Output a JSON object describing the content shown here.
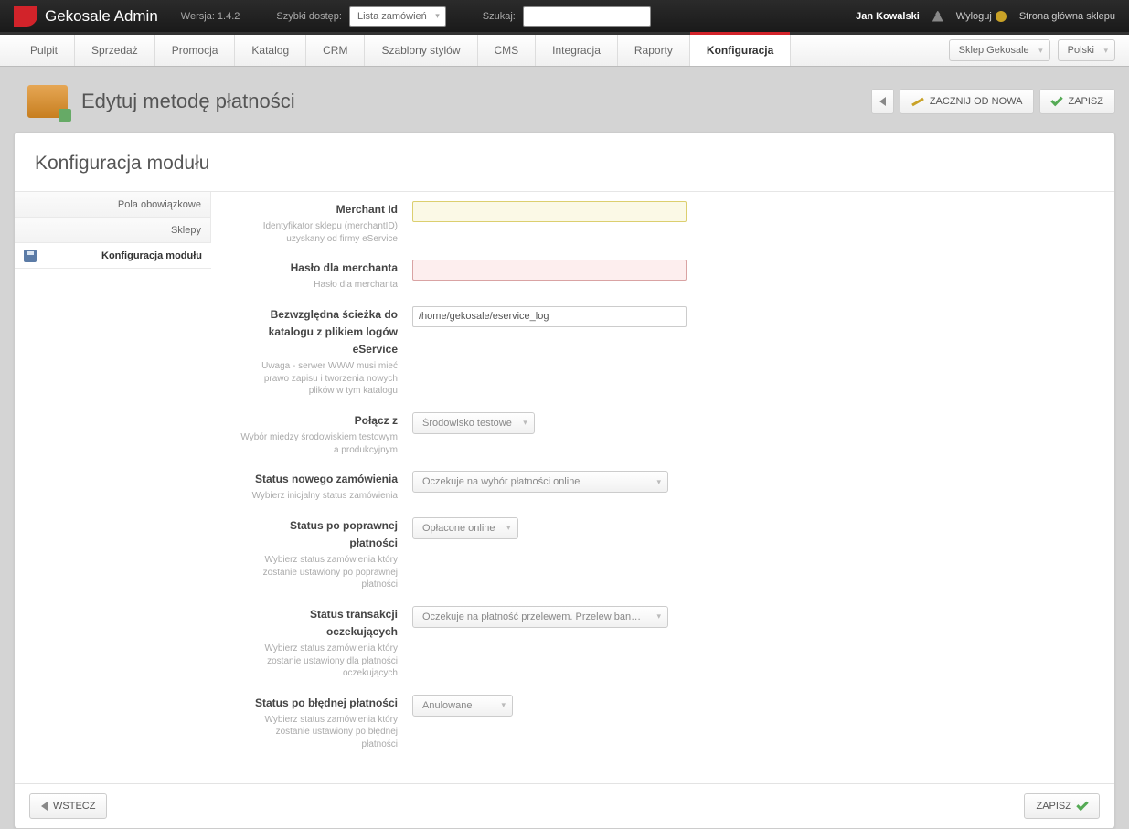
{
  "topbar": {
    "brand": "Gekosale Admin",
    "version": "Wersja: 1.4.2",
    "quick_access_label": "Szybki dostęp:",
    "quick_access_value": "Lista zamówień",
    "search_label": "Szukaj:",
    "search_value": "",
    "user": "Jan Kowalski",
    "logout": "Wyloguj",
    "storefront": "Strona główna sklepu"
  },
  "mainnav": {
    "items": [
      "Pulpit",
      "Sprzedaż",
      "Promocja",
      "Katalog",
      "CRM",
      "Szablony stylów",
      "CMS",
      "Integracja",
      "Raporty",
      "Konfiguracja"
    ],
    "active": "Konfiguracja",
    "shop_select": "Sklep Gekosale",
    "lang_select": "Polski"
  },
  "pagehead": {
    "title": "Edytuj metodę płatności",
    "back_tooltip": "Wstecz",
    "restart": "ZACZNIJ OD NOWA",
    "save": "ZAPISZ"
  },
  "panel": {
    "title": "Konfiguracja modułu"
  },
  "sidenav": {
    "items": [
      "Pola obowiązkowe",
      "Sklepy",
      "Konfiguracja modułu"
    ],
    "active": "Konfiguracja modułu"
  },
  "form": {
    "merchant_id": {
      "label": "Merchant Id",
      "help": "Identyfikator sklepu (merchantID) uzyskany od firmy eService",
      "value": ""
    },
    "merchant_pwd": {
      "label": "Hasło dla merchanta",
      "help": "Hasło dla merchanta",
      "value": ""
    },
    "log_path": {
      "label": "Bezwzględna ścieżka do katalogu z plikiem logów eService",
      "help": "Uwaga - serwer WWW musi mieć prawo zapisu i tworzenia nowych plików w tym katalogu",
      "value": "/home/gekosale/eservice_log"
    },
    "connect": {
      "label": "Połącz z",
      "help": "Wybór między środowiskiem testowym a produkcyjnym",
      "value": "Środowisko testowe"
    },
    "status_new": {
      "label": "Status nowego zamówienia",
      "help": "Wybierz inicjalny status zamówienia",
      "value": "Oczekuje na wybór płatności online"
    },
    "status_ok": {
      "label": "Status po poprawnej płatności",
      "help": "Wybierz status zamówienia który zostanie ustawiony po poprawnej płatności",
      "value": "Opłacone online"
    },
    "status_pending": {
      "label": "Status transakcji oczekujących",
      "help": "Wybierz status zamówienia który zostanie ustawiony dla płatności oczekujących",
      "value": "Oczekuje na płatność przelewem. Przelew bankowy"
    },
    "status_fail": {
      "label": "Status po błędnej płatności",
      "help": "Wybierz status zamówienia który zostanie ustawiony po błędnej płatności",
      "value": "Anulowane"
    }
  },
  "footer": {
    "back": "WSTECZ",
    "save": "ZAPISZ"
  }
}
